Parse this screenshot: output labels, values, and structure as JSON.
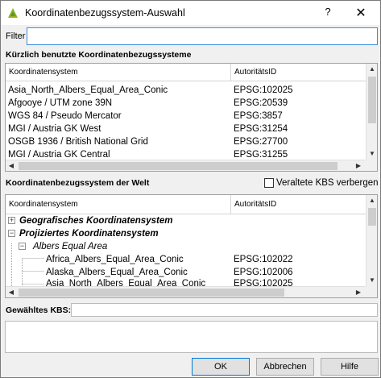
{
  "window": {
    "title": "Koordinatenbezugssystem-Auswahl",
    "help_label": "?",
    "close_label": "✕"
  },
  "filter": {
    "label": "Filter",
    "value": ""
  },
  "recent": {
    "title": "Kürzlich benutzte Koordinatenbezugssysteme",
    "columns": [
      "Koordinatensystem",
      "AutoritätsID"
    ],
    "rows": [
      {
        "name": "Asia_North_Albers_Equal_Area_Conic",
        "id": "EPSG:102025"
      },
      {
        "name": "Afgooye / UTM zone 39N",
        "id": "EPSG:20539"
      },
      {
        "name": "WGS 84 / Pseudo Mercator",
        "id": "EPSG:3857"
      },
      {
        "name": "MGI / Austria GK West",
        "id": "EPSG:31254"
      },
      {
        "name": "OSGB 1936 / British National Grid",
        "id": "EPSG:27700"
      },
      {
        "name": "MGI / Austria GK Central",
        "id": "EPSG:31255"
      }
    ]
  },
  "world": {
    "title": "Koordinatenbezugssystem der Welt",
    "hide_deprecated_label": "Veraltete KBS verbergen",
    "hide_deprecated_checked": false,
    "columns": [
      "Koordinatensystem",
      "AutoritätsID"
    ],
    "tree": [
      {
        "label": "Geografisches Koordinatensystem",
        "id": ""
      },
      {
        "label": "Projiziertes Koordinatensystem",
        "id": ""
      },
      {
        "label": "Albers Equal Area",
        "id": ""
      },
      {
        "label": "Africa_Albers_Equal_Area_Conic",
        "id": "EPSG:102022"
      },
      {
        "label": "Alaska_Albers_Equal_Area_Conic",
        "id": "EPSG:102006"
      },
      {
        "label": "Asia_North_Albers_Equal_Area_Conic",
        "id": "EPSG:102025"
      }
    ]
  },
  "selected": {
    "label": "Gewähltes KBS:",
    "value": ""
  },
  "buttons": {
    "ok": "OK",
    "cancel": "Abbrechen",
    "help": "Hilfe"
  }
}
